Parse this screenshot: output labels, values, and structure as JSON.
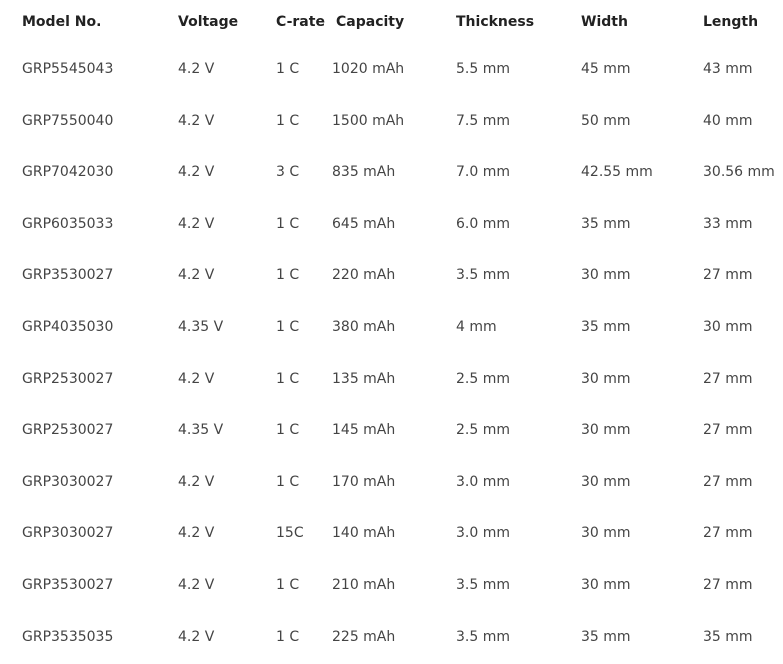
{
  "table": {
    "headers": {
      "model": "Model No.",
      "voltage": "Voltage",
      "crate": "C-rate",
      "capacity": "Capacity",
      "thickness": "Thickness",
      "width": "Width",
      "length": "Length"
    },
    "rows": [
      {
        "model": "GRP5545043",
        "voltage": "4.2 V",
        "crate": "1 C",
        "capacity": "1020 mAh",
        "thickness": "5.5 mm",
        "width": "45 mm",
        "length": "43 mm"
      },
      {
        "model": "GRP7550040",
        "voltage": "4.2 V",
        "crate": "1 C",
        "capacity": "1500 mAh",
        "thickness": "7.5 mm",
        "width": "50 mm",
        "length": "40 mm"
      },
      {
        "model": "GRP7042030",
        "voltage": "4.2 V",
        "crate": "3 C",
        "capacity": "835 mAh",
        "thickness": "7.0 mm",
        "width": "42.55 mm",
        "length": "30.56 mm"
      },
      {
        "model": "GRP6035033",
        "voltage": "4.2 V",
        "crate": "1 C",
        "capacity": "645 mAh",
        "thickness": "6.0 mm",
        "width": "35 mm",
        "length": "33 mm"
      },
      {
        "model": "GRP3530027",
        "voltage": "4.2 V",
        "crate": "1 C",
        "capacity": "220 mAh",
        "thickness": "3.5 mm",
        "width": "30 mm",
        "length": "27 mm"
      },
      {
        "model": "GRP4035030",
        "voltage": "4.35 V",
        "crate": "1 C",
        "capacity": "380 mAh",
        "thickness": "4 mm",
        "width": "35 mm",
        "length": "30 mm"
      },
      {
        "model": "GRP2530027",
        "voltage": "4.2 V",
        "crate": "1 C",
        "capacity": "135 mAh",
        "thickness": "2.5 mm",
        "width": "30 mm",
        "length": "27 mm"
      },
      {
        "model": "GRP2530027",
        "voltage": "4.35 V",
        "crate": "1 C",
        "capacity": "145 mAh",
        "thickness": "2.5 mm",
        "width": "30 mm",
        "length": "27 mm"
      },
      {
        "model": "GRP3030027",
        "voltage": "4.2 V",
        "crate": "1 C",
        "capacity": "170 mAh",
        "thickness": "3.0 mm",
        "width": "30 mm",
        "length": "27 mm"
      },
      {
        "model": "GRP3030027",
        "voltage": "4.2 V",
        "crate": "15C",
        "capacity": "140 mAh",
        "thickness": "3.0 mm",
        "width": "30 mm",
        "length": "27 mm"
      },
      {
        "model": "GRP3530027",
        "voltage": "4.2 V",
        "crate": "1 C",
        "capacity": "210 mAh",
        "thickness": "3.5 mm",
        "width": "30 mm",
        "length": "27 mm"
      },
      {
        "model": "GRP3535035",
        "voltage": "4.2 V",
        "crate": "1 C",
        "capacity": "225 mAh",
        "thickness": "3.5 mm",
        "width": "35 mm",
        "length": "35 mm"
      }
    ]
  }
}
